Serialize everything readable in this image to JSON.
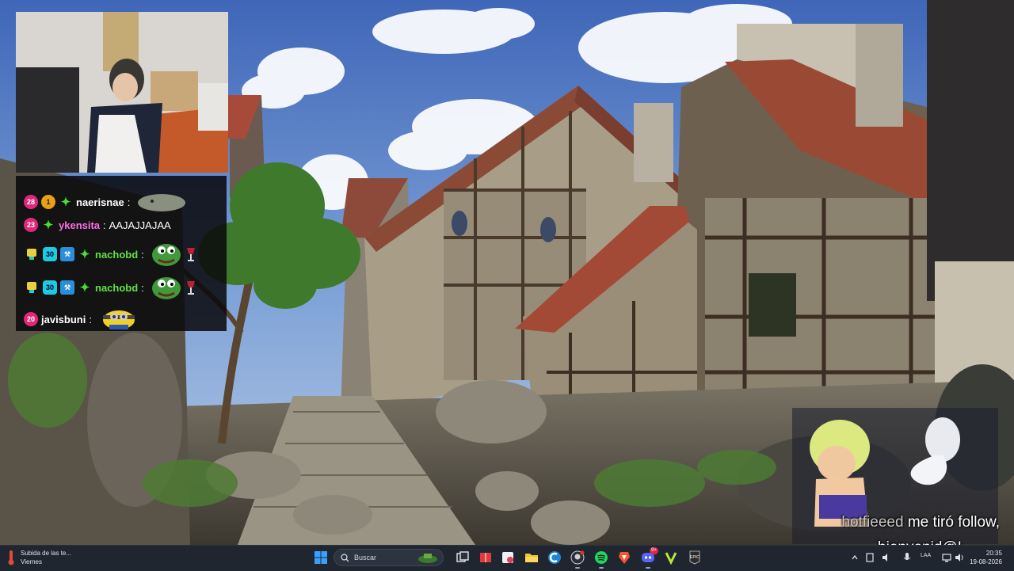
{
  "chat": {
    "messages": [
      {
        "user": "naerisnae",
        "text": "",
        "user_color": "#ffffff",
        "badges": [
          "28",
          "1",
          "star"
        ],
        "emote": "rock"
      },
      {
        "user": "ykensita",
        "text": "AAJAJJAJAA",
        "user_color": "#ff6ee6",
        "badges": [
          "23",
          "star"
        ],
        "emote": ""
      },
      {
        "user": "nachobd",
        "text": "",
        "user_color": "#62e048",
        "badges": [
          "cup",
          "30",
          "tool",
          "star"
        ],
        "emote": "frog"
      },
      {
        "user": "nachobd",
        "text": "",
        "user_color": "#62e048",
        "badges": [
          "cup",
          "30",
          "tool",
          "star"
        ],
        "emote": "frog"
      },
      {
        "user": "javisbuni",
        "text": "",
        "user_color": "#ffffff",
        "badges": [
          "20"
        ],
        "emote": "minion"
      }
    ],
    "separator": ":"
  },
  "follow_alert": {
    "username": "hotfieeed",
    "message": "me tiró follow,",
    "message2": "bienvenid@!"
  },
  "taskbar": {
    "weather_line1": "Subida de las te...",
    "weather_line2": "Viernes",
    "search_placeholder": "Buscar",
    "language": "LAA",
    "time": "20:35",
    "date": "19-08-2026",
    "discord_badge": "9+"
  },
  "colors": {
    "taskbar_bg": "#1f2630",
    "chat_bg": "#08080a",
    "sub_badge": "#e0287a"
  }
}
